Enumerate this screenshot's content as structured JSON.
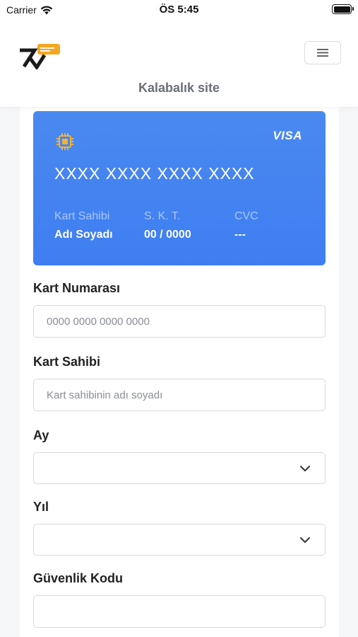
{
  "status_bar": {
    "carrier": "Carrier",
    "time": "ÖS 5:45",
    "icons": [
      "wifi-icon",
      "battery-icon"
    ]
  },
  "header": {
    "site_title": "Kalabalık site",
    "menu_icon": "hamburger-icon",
    "logo_icon": "brand-logo-icon"
  },
  "card": {
    "brand": "VISA",
    "chip_icon": "chip-icon",
    "number": "XXXX XXXX XXXX XXXX",
    "holder_label": "Kart Sahibi",
    "holder_value": "Adı Soyadı",
    "expiry_label": "S. K. T.",
    "expiry_value": "00 / 0000",
    "cvc_label": "CVC",
    "cvc_value": "---",
    "colors": {
      "gradient_top": "#4a89f0",
      "gradient_bottom": "#3f7ef1"
    }
  },
  "form": {
    "card_number": {
      "label": "Kart Numarası",
      "placeholder": "0000 0000 0000 0000",
      "value": ""
    },
    "card_holder": {
      "label": "Kart Sahibi",
      "placeholder": "Kart sahibinin adı soyadı",
      "value": ""
    },
    "month": {
      "label": "Ay",
      "selected": ""
    },
    "year": {
      "label": "Yıl",
      "selected": ""
    },
    "security_code": {
      "label": "Güvenlik Kodu",
      "placeholder": "",
      "value": ""
    }
  }
}
